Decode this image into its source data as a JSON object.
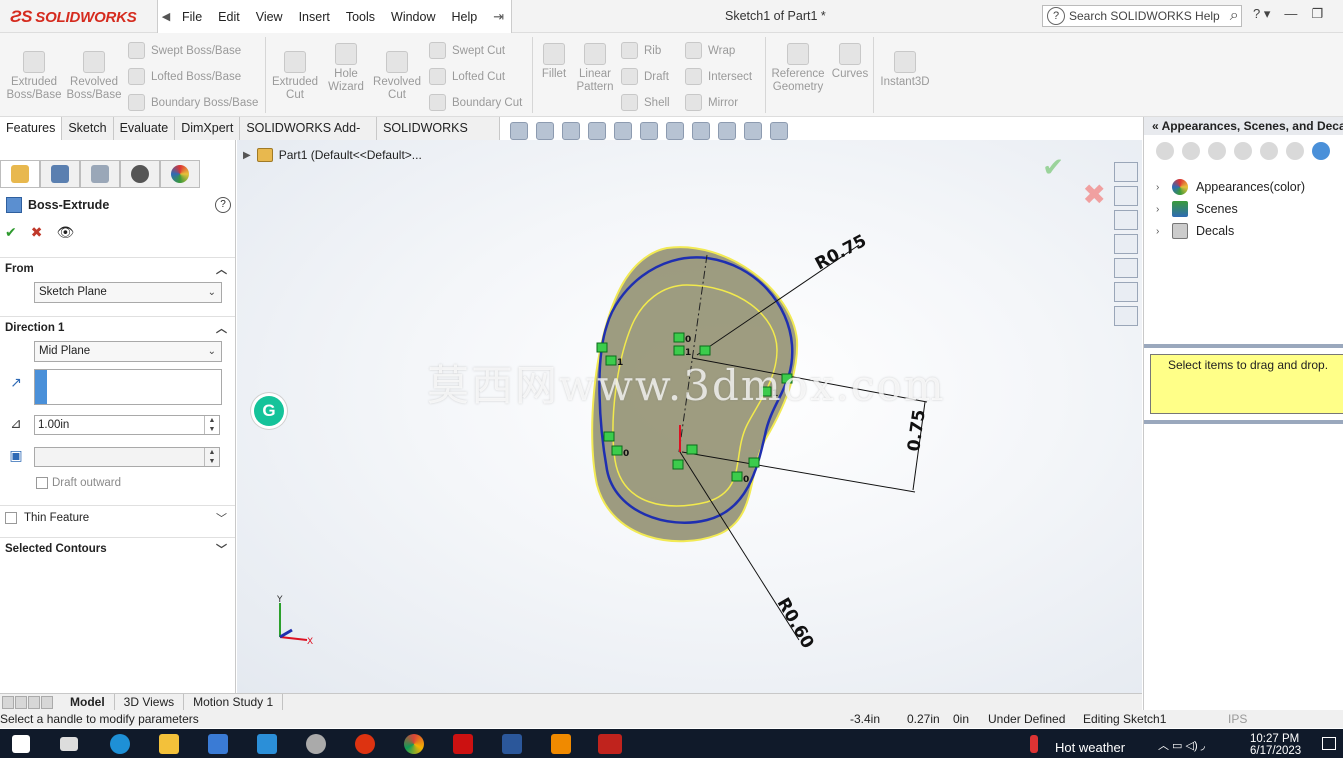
{
  "app": {
    "name": "SOLIDWORKS",
    "doc_title": "Sketch1 of Part1 *"
  },
  "menus": [
    "File",
    "Edit",
    "View",
    "Insert",
    "Tools",
    "Window",
    "Help"
  ],
  "search": {
    "placeholder": "Search SOLIDWORKS Help"
  },
  "toolbar": {
    "extruded_boss": "Extruded Boss/Base",
    "revolved_boss": "Revolved Boss/Base",
    "swept_boss": "Swept Boss/Base",
    "lofted_boss": "Lofted Boss/Base",
    "boundary_boss": "Boundary Boss/Base",
    "extruded_cut": "Extruded Cut",
    "hole_wizard": "Hole Wizard",
    "revolved_cut": "Revolved Cut",
    "swept_cut": "Swept Cut",
    "lofted_cut": "Lofted Cut",
    "boundary_cut": "Boundary Cut",
    "fillet": "Fillet",
    "linear_pattern": "Linear Pattern",
    "rib": "Rib",
    "draft": "Draft",
    "shell": "Shell",
    "wrap": "Wrap",
    "intersect": "Intersect",
    "mirror": "Mirror",
    "reference_geometry": "Reference Geometry",
    "curves": "Curves",
    "instant3d": "Instant3D"
  },
  "command_tabs": [
    "Features",
    "Sketch",
    "Evaluate",
    "DimXpert",
    "SOLIDWORKS Add-Ins",
    "SOLIDWORKS MBD"
  ],
  "property_manager": {
    "title": "Boss-Extrude",
    "from": {
      "label": "From",
      "value": "Sketch Plane"
    },
    "direction1": {
      "label": "Direction 1",
      "value": "Mid Plane",
      "depth": "1.00in"
    },
    "draft_outward": "Draft outward",
    "thin_feature": "Thin Feature",
    "selected_contours": "Selected Contours"
  },
  "feature_tree": {
    "root": "Part1  (Default<<Default>..."
  },
  "dimensions": {
    "r_top": "R0.75",
    "r_bottom": "R0.60",
    "distance": "0.75"
  },
  "watermark": "莫西网www.3dmox.com",
  "bottom_tabs": [
    "Model",
    "3D Views",
    "Motion Study 1"
  ],
  "status": {
    "message": "Select a handle to modify parameters",
    "x": "-3.4in",
    "y": "0.27in",
    "z": "0in",
    "state": "Under Defined",
    "editing": "Editing Sketch1",
    "units": "IPS"
  },
  "task_pane": {
    "title": "Appearances, Scenes, and Decals",
    "items": [
      "Appearances(color)",
      "Scenes",
      "Decals"
    ],
    "drag_hint": "Select items to drag and drop."
  },
  "taskbar": {
    "weather": "Hot weather",
    "time": "10:27 PM",
    "date": "6/17/2023"
  }
}
